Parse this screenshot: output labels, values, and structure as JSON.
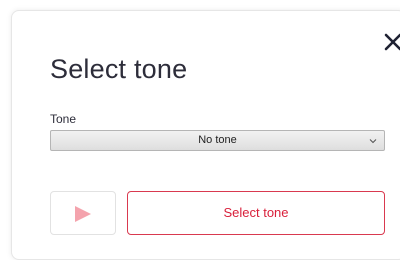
{
  "dialog": {
    "title": "Select tone",
    "close_icon": "close-icon",
    "tone_field": {
      "label": "Tone",
      "selected_value": "No tone",
      "icon": "chevron-down-icon"
    },
    "play_button": {
      "icon": "play-icon",
      "disabled": true
    },
    "primary_button": {
      "label": "Select tone"
    }
  },
  "colors": {
    "accent": "#d9203b",
    "play_icon_disabled": "#f4a3ad",
    "title_text": "#2d2d3a"
  }
}
